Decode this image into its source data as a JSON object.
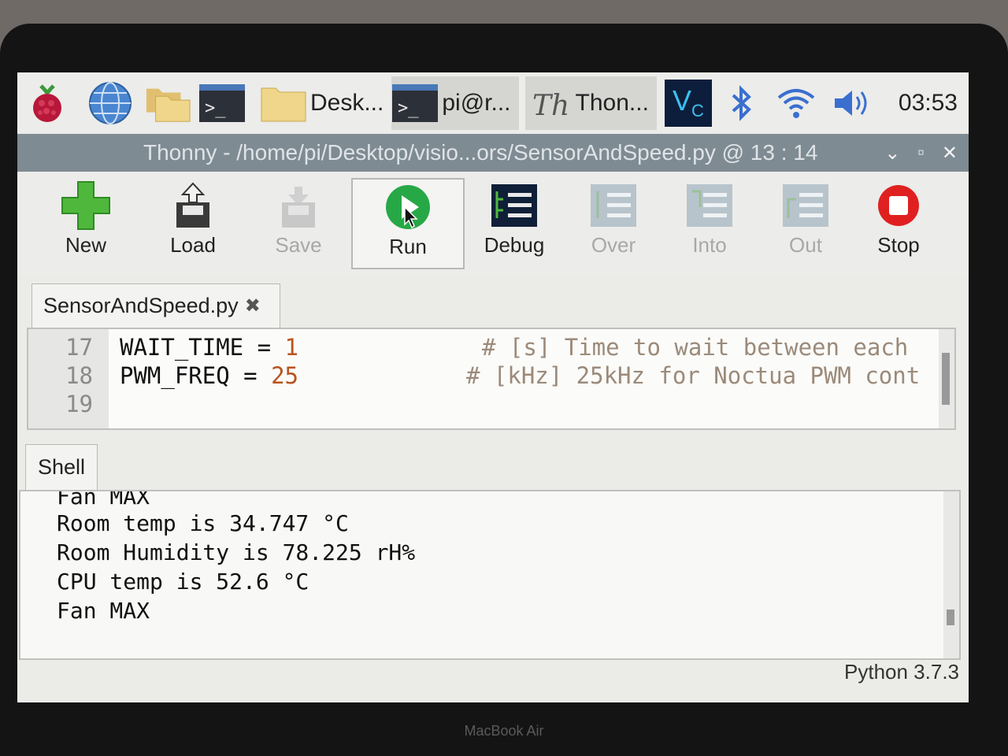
{
  "taskbar": {
    "items": [
      {
        "name": "raspberry-menu",
        "label": ""
      },
      {
        "name": "web-browser",
        "label": ""
      },
      {
        "name": "file-manager",
        "label": ""
      },
      {
        "name": "terminal",
        "label": ""
      },
      {
        "name": "desktop-window",
        "label": "Desk..."
      },
      {
        "name": "terminal-window",
        "label": "pi@r..."
      },
      {
        "name": "thonny-window",
        "label": "Thon..."
      }
    ],
    "clock": "03:53"
  },
  "titlebar": {
    "title": "Thonny  -  /home/pi/Desktop/visio...ors/SensorAndSpeed.py  @  13 : 14"
  },
  "toolbar": {
    "new": "New",
    "load": "Load",
    "save": "Save",
    "run": "Run",
    "debug": "Debug",
    "over": "Over",
    "into": "Into",
    "out": "Out",
    "stop": "Stop"
  },
  "editor": {
    "tab": "SensorAndSpeed.py",
    "lines": [
      {
        "no": "17",
        "var": "WAIT_TIME = ",
        "val": "1",
        "comment": "# [s] Time to wait between each"
      },
      {
        "no": "18",
        "var": "PWM_FREQ = ",
        "val": "25",
        "comment": "# [kHz] 25kHz for Noctua PWM cont"
      },
      {
        "no": "19",
        "var": "",
        "val": "",
        "comment": ""
      }
    ]
  },
  "shell": {
    "tab": "Shell",
    "lines": [
      "Fan MAX",
      "Room temp is 34.747 °C",
      "Room Humidity is 78.225 rH%",
      "CPU temp is 52.6 °C",
      "Fan MAX"
    ]
  },
  "status": {
    "python": "Python 3.7.3"
  },
  "device": {
    "label": "MacBook Air"
  },
  "colors": {
    "run_green": "#27a846",
    "stop_red": "#e02020",
    "title_bar": "#7f8b93"
  }
}
